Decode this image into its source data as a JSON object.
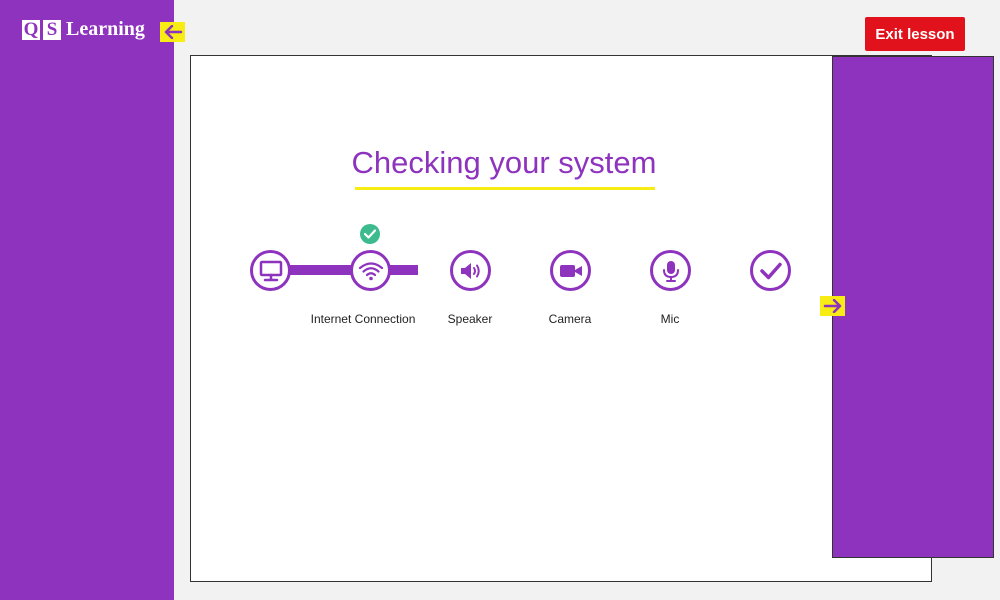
{
  "brand": {
    "logo_letters": [
      "Q",
      "S"
    ],
    "logo_word": "Learning"
  },
  "header": {
    "exit_label": "Exit lesson"
  },
  "main": {
    "title": "Checking your system"
  },
  "steps": [
    {
      "icon": "monitor-icon",
      "label": "",
      "status": "done"
    },
    {
      "icon": "wifi-icon",
      "label": "Internet Connection",
      "status": "done"
    },
    {
      "icon": "speaker-icon",
      "label": "Speaker",
      "status": "pending"
    },
    {
      "icon": "camera-icon",
      "label": "Camera",
      "status": "pending"
    },
    {
      "icon": "mic-icon",
      "label": "Mic",
      "status": "pending"
    },
    {
      "icon": "check-icon",
      "label": "",
      "status": "pending"
    }
  ],
  "colors": {
    "brand": "#8e33be",
    "accent": "#f7ec13",
    "exit": "#e2121c",
    "success": "#3dbb8e"
  }
}
